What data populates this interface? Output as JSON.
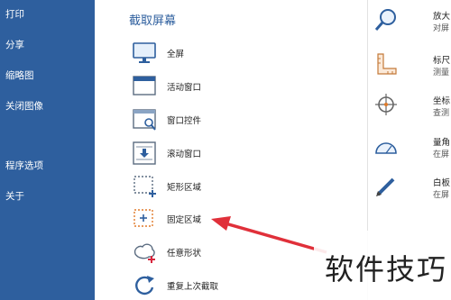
{
  "sidebar": {
    "items": [
      {
        "label": "打印"
      },
      {
        "label": "分享"
      },
      {
        "label": "缩略图"
      },
      {
        "label": "关闭图像"
      },
      {
        "label": "程序选项"
      },
      {
        "label": "关于"
      }
    ]
  },
  "capture": {
    "title": "截取屏幕",
    "items": [
      {
        "label": "全屏",
        "icon": "monitor-icon"
      },
      {
        "label": "活动窗口",
        "icon": "window-icon"
      },
      {
        "label": "窗口控件",
        "icon": "window-control-icon"
      },
      {
        "label": "滚动窗口",
        "icon": "scroll-window-icon"
      },
      {
        "label": "矩形区域",
        "icon": "rectangle-region-icon"
      },
      {
        "label": "固定区域",
        "icon": "fixed-region-icon"
      },
      {
        "label": "任意形状",
        "icon": "freehand-shape-icon"
      },
      {
        "label": "重复上次截取",
        "icon": "repeat-icon"
      }
    ]
  },
  "tools": {
    "items": [
      {
        "title": "放大",
        "sub": "对屏",
        "icon": "magnifier-icon"
      },
      {
        "title": "标尺",
        "sub": "测量",
        "icon": "ruler-icon"
      },
      {
        "title": "坐标",
        "sub": "查测",
        "icon": "crosshair-icon"
      },
      {
        "title": "量角",
        "sub": "在屏",
        "icon": "protractor-icon"
      },
      {
        "title": "白板",
        "sub": "在屏",
        "icon": "pen-icon"
      }
    ]
  },
  "watermark": {
    "text": "软件技巧"
  },
  "colors": {
    "sidebar": "#2e5f9e",
    "accent": "#2e5f9e",
    "arrow": "#e0303a"
  }
}
